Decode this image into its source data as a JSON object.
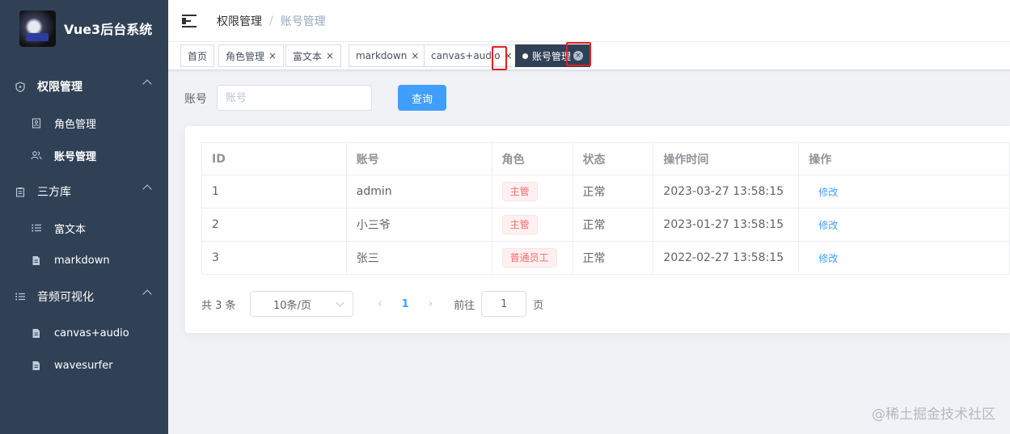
{
  "app": {
    "title": "Vue3后台系统"
  },
  "sidebar": {
    "groups": [
      {
        "label": "权限管理",
        "icon": "shield-icon",
        "items": [
          {
            "label": "角色管理",
            "icon": "role-doc-icon"
          },
          {
            "label": "账号管理",
            "icon": "user-group-icon"
          }
        ]
      },
      {
        "label": "三方库",
        "icon": "clipboard-icon",
        "items": [
          {
            "label": "富文本",
            "icon": "list-icon"
          },
          {
            "label": "markdown",
            "icon": "file-edit-icon"
          }
        ]
      },
      {
        "label": "音频可视化",
        "icon": "list-icon",
        "items": [
          {
            "label": "canvas+audio",
            "icon": "file-edit-icon"
          },
          {
            "label": "wavesurfer",
            "icon": "file-edit-icon"
          }
        ]
      }
    ]
  },
  "header": {
    "breadcrumb": [
      "权限管理",
      "账号管理"
    ],
    "breadcrumb_separator": "/"
  },
  "tags": {
    "items": [
      "首页",
      "角色管理",
      "富文本",
      "markdown",
      "canvas+audio",
      "账号管理"
    ],
    "close_glyph": "×",
    "active_close_glyph": "×"
  },
  "search": {
    "label": "账号",
    "placeholder": "账号",
    "button": "查询"
  },
  "table": {
    "columns": [
      "ID",
      "账号",
      "角色",
      "状态",
      "操作时间",
      "操作"
    ],
    "rows": [
      {
        "id": "1",
        "account": "admin",
        "role": "主管",
        "status": "正常",
        "time": "2023-03-27 13:58:15",
        "action": "修改"
      },
      {
        "id": "2",
        "account": "小三爷",
        "role": "主管",
        "status": "正常",
        "time": "2023-01-27 13:58:15",
        "action": "修改"
      },
      {
        "id": "3",
        "account": "张三",
        "role": "普通员工",
        "status": "正常",
        "time": "2022-02-27 13:58:15",
        "action": "修改"
      }
    ]
  },
  "pagination": {
    "total": "共 3 条",
    "page_size": "10条/页",
    "current_page": "1",
    "goto_label": "前往",
    "goto_value": "1",
    "goto_unit": "页",
    "prev_glyph": "‹",
    "next_glyph": "›"
  },
  "watermark": "@稀土掘金技术社区",
  "colors": {
    "sidebar_bg": "#304156",
    "primary": "#409eff",
    "danger": "#f56c6c",
    "highlight": "#e02020"
  }
}
